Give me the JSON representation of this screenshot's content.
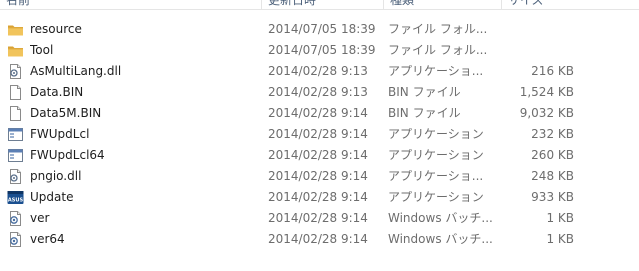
{
  "header": {
    "columns": [
      "名前",
      "更新日時",
      "種類",
      "サイズ"
    ]
  },
  "files": [
    {
      "name": "resource",
      "date": "2014/07/05 18:39",
      "type": "ファイル フォル...",
      "size": "",
      "icon": "folder-icon"
    },
    {
      "name": "Tool",
      "date": "2014/07/05 18:39",
      "type": "ファイル フォル...",
      "size": "",
      "icon": "folder-icon"
    },
    {
      "name": "AsMultiLang.dll",
      "date": "2014/02/28 9:13",
      "type": "アプリケーショ...",
      "size": "216 KB",
      "icon": "dll-file-icon"
    },
    {
      "name": "Data.BIN",
      "date": "2014/02/28 9:13",
      "type": "BIN ファイル",
      "size": "1,524 KB",
      "icon": "blank-file-icon"
    },
    {
      "name": "Data5M.BIN",
      "date": "2014/02/28 9:14",
      "type": "BIN ファイル",
      "size": "9,032 KB",
      "icon": "blank-file-icon"
    },
    {
      "name": "FWUpdLcl",
      "date": "2014/02/28 9:14",
      "type": "アプリケーション",
      "size": "232 KB",
      "icon": "application-icon"
    },
    {
      "name": "FWUpdLcl64",
      "date": "2014/02/28 9:14",
      "type": "アプリケーション",
      "size": "260 KB",
      "icon": "application-icon"
    },
    {
      "name": "pngio.dll",
      "date": "2014/02/28 9:14",
      "type": "アプリケーショ...",
      "size": "248 KB",
      "icon": "dll-file-icon"
    },
    {
      "name": "Update",
      "date": "2014/02/28 9:14",
      "type": "アプリケーション",
      "size": "933 KB",
      "icon": "asus-app-icon"
    },
    {
      "name": "ver",
      "date": "2014/02/28 9:14",
      "type": "Windows バッチ...",
      "size": "1 KB",
      "icon": "batch-file-icon"
    },
    {
      "name": "ver64",
      "date": "2014/02/28 9:14",
      "type": "Windows バッチ...",
      "size": "1 KB",
      "icon": "batch-file-icon"
    }
  ],
  "colors": {
    "folder": "#e8b33f",
    "asus_blue": "#1a4f8f"
  }
}
